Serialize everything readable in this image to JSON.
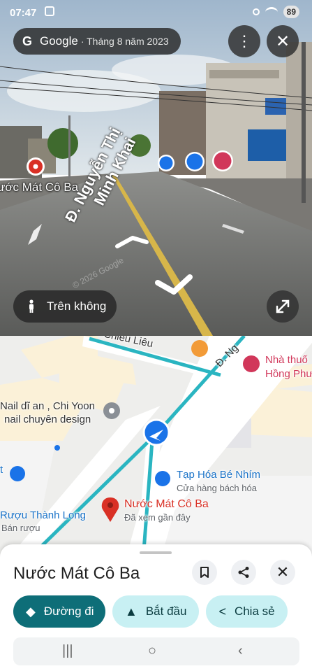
{
  "status_bar": {
    "time": "07:47",
    "battery": "89"
  },
  "streetview": {
    "brand": "Google",
    "date": "· Tháng 8 năm 2023",
    "place_label": "ước Mát Cô Ba",
    "street_label_line1": "Đ. Nguyễn Thị",
    "street_label_line2": "Minh Khai",
    "watermark": "© 2026 Google",
    "aerial_button_label": "Trên không"
  },
  "map": {
    "street_top": "Chiêu Liêu",
    "street_ng": "Đ. Ng",
    "pharmacy_line1": "Nhà thuố",
    "pharmacy_line2": "Hồng Phư",
    "nail_line1": "Nail dĩ an , Chi Yoon",
    "nail_line2": "nail chuyên design",
    "tap_hoa_name": "Tạp Hóa Bé Nhím",
    "tap_hoa_type": "Cửa hàng bách hóa",
    "ruou_name": "Rượu Thành Long",
    "ruou_type": "Bán rượu",
    "selected_name": "Nước Mát Cô Ba",
    "selected_note": "Đã xem gần đây",
    "edge_letter": "t"
  },
  "sheet": {
    "title": "Nước Mát Cô Ba",
    "chips": [
      "Đường đi",
      "Bắt đầu",
      "Chia sẻ"
    ]
  },
  "colors": {
    "route": "#2ab5c1",
    "primary_chip": "#0e6e78",
    "secondary_chip": "#c8f0f3",
    "pin": "#d93025"
  }
}
